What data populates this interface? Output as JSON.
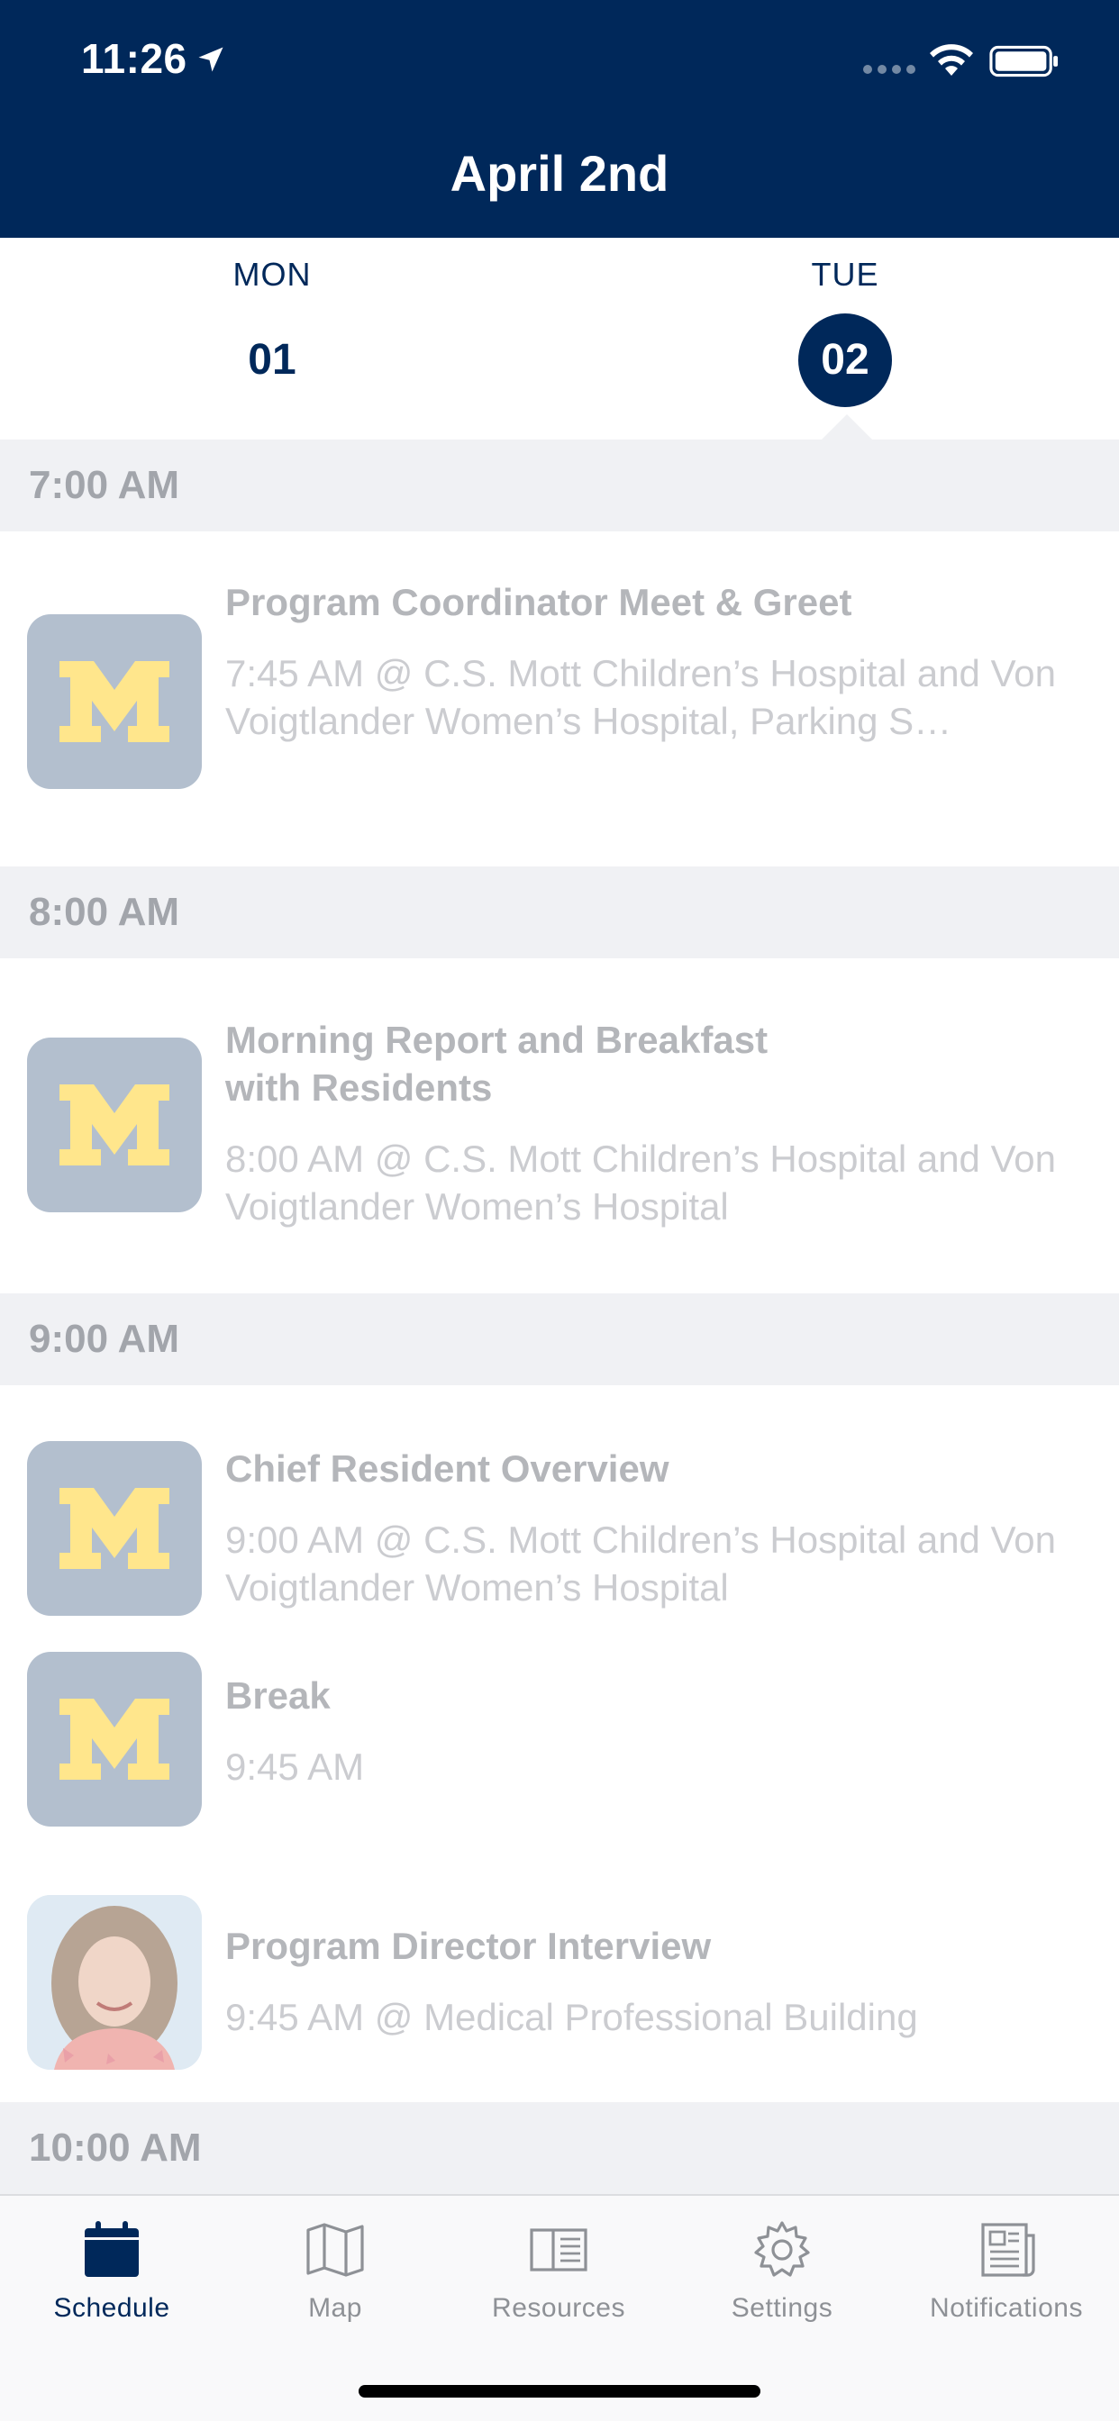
{
  "status": {
    "time": "11:26"
  },
  "header": {
    "title": "April 2nd"
  },
  "days": [
    {
      "name": "MON",
      "num": "01"
    },
    {
      "name": "TUE",
      "num": "02",
      "selected": true
    }
  ],
  "sections": [
    {
      "time": "7:00 AM",
      "events": [
        {
          "title": "Program Coordinator Meet & Greet",
          "subtitle": "7:45 AM @ C.S. Mott Children’s Hospital and Von Voigtlander Women’s Hospital, Parking S…",
          "thumb": "michigan-m-logo"
        }
      ]
    },
    {
      "time": "8:00 AM",
      "events": [
        {
          "title": "Morning Report and Breakfast with Residents",
          "subtitle": "8:00 AM @ C.S. Mott Children’s Hospital and Von Voigtlander Women’s Hospital",
          "thumb": "michigan-m-logo"
        }
      ]
    },
    {
      "time": "9:00 AM",
      "events": [
        {
          "title": "Chief Resident Overview",
          "subtitle": "9:00 AM @ C.S. Mott Children’s Hospital and Von Voigtlander Women’s Hospital",
          "thumb": "michigan-m-logo"
        },
        {
          "title": "Break",
          "subtitle": "9:45 AM",
          "thumb": "michigan-m-logo"
        },
        {
          "title": "Program Director Interview",
          "subtitle": "9:45 AM @ Medical Professional Building",
          "thumb": "person-photo"
        }
      ]
    },
    {
      "time": "10:00 AM",
      "events": []
    }
  ],
  "tabs": [
    {
      "label": "Schedule",
      "icon": "calendar-icon",
      "active": true
    },
    {
      "label": "Map",
      "icon": "map-icon"
    },
    {
      "label": "Resources",
      "icon": "book-icon"
    },
    {
      "label": "Settings",
      "icon": "gear-icon"
    },
    {
      "label": "Notifications",
      "icon": "newspaper-icon"
    }
  ],
  "colors": {
    "navy": "#00285a",
    "maize": "#ffe68c",
    "section_bg": "#f0f1f4"
  }
}
